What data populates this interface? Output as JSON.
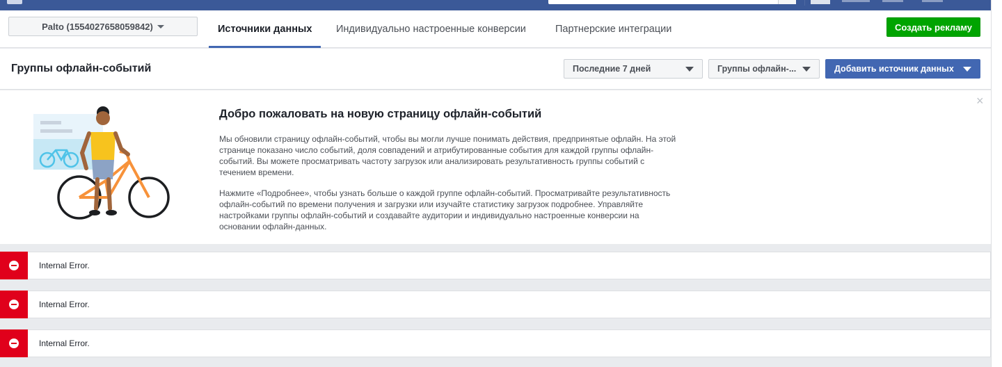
{
  "account_selector": {
    "label": "Palto (1554027658059842)"
  },
  "tabs": [
    {
      "label": "Источники данных",
      "active": true
    },
    {
      "label": "Индивидуально настроенные конверсии",
      "active": false
    },
    {
      "label": "Партнерские интеграции",
      "active": false
    }
  ],
  "create_ad_button": "Создать рекламу",
  "page_title": "Группы офлайн-событий",
  "controls": {
    "date_range": "Последние 7 дней",
    "event_groups": "Группы офлайн-...",
    "add_data_source": "Добавить источник данных"
  },
  "welcome": {
    "title": "Добро пожаловать на новую страницу офлайн-событий",
    "paragraph1": [
      "Мы обновили страницу офлайн-событий, чтобы вы могли лучше понимать действия, предпринятые офлайн. На этой",
      "странице показано число событий, доля совпадений и атрибутированные события для каждой группы офлайн-",
      "событий. Вы можете просматривать частоту загрузок или анализировать результативность группы событий с",
      "течением времени."
    ],
    "paragraph2": [
      "Нажмите «Подробнее», чтобы узнать больше о каждой группе офлайн-событий. Просматривайте результативность",
      "офлайн-событий по времени получения и загрузки или изучайте статистику загрузок подробнее. Управляйте",
      "настройками группы офлайн-событий и создавайте аудитории и индивидуально настроенные конверсии на",
      "основании офлайн-данных."
    ],
    "close_glyph": "×"
  },
  "errors": [
    {
      "message": "Internal Error."
    },
    {
      "message": "Internal Error."
    },
    {
      "message": "Internal Error."
    }
  ],
  "colors": {
    "topbar": "#3b5998",
    "primary": "#4267b2",
    "create_ad": "#00a400",
    "error": "#e0001b"
  }
}
